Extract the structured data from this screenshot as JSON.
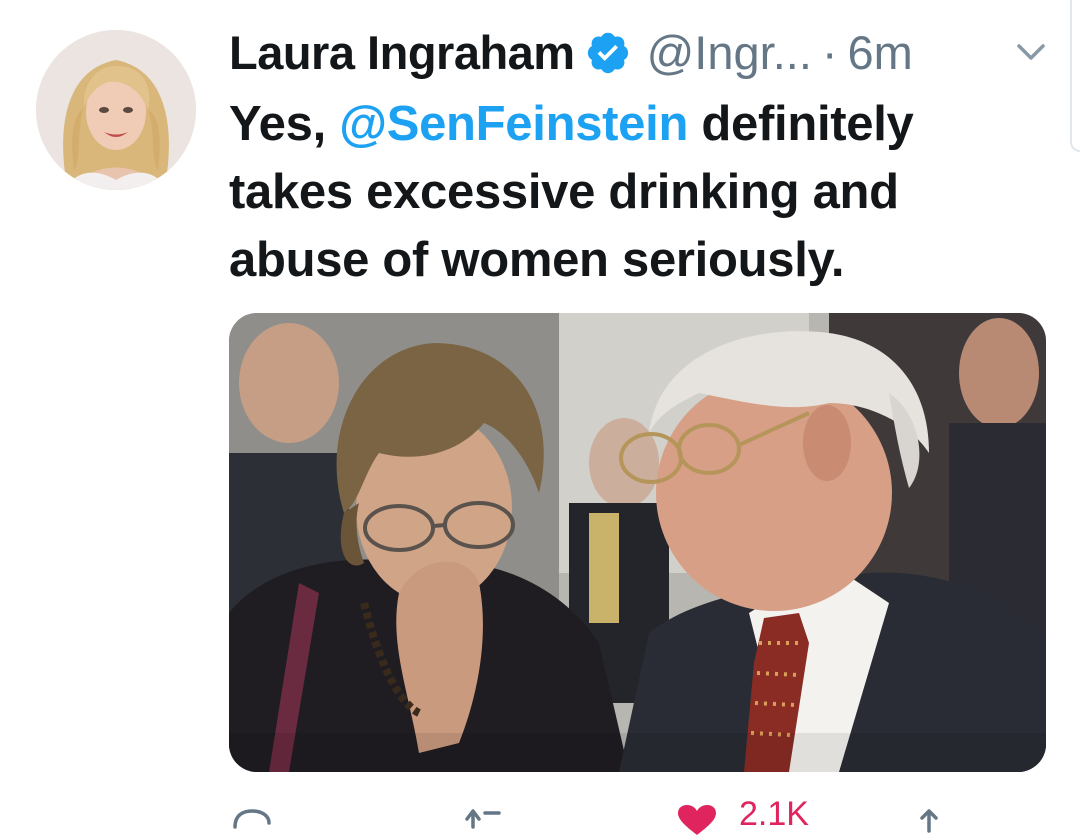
{
  "tweet": {
    "author": {
      "display_name": "Laura Ingraham",
      "handle": "@Ingr...",
      "verified_icon": "verified-badge-icon",
      "avatar_icon": "avatar"
    },
    "separator": "·",
    "time": "6m",
    "text": {
      "line1_prefix": "Yes,",
      "mention": "@SenFeinstein",
      "line1_suffix": "definitely",
      "line2": "takes excessive drinking and",
      "line3": "abuse of women seriously."
    },
    "media": {
      "icon": "photo"
    },
    "actions": {
      "reply_icon": "reply-icon",
      "retweet_icon": "retweet-icon",
      "like_icon": "heart-icon",
      "like_count": "2.1K",
      "share_icon": "share-icon"
    },
    "menu_icon": "chevron-down-icon"
  },
  "colors": {
    "text": "#14171a",
    "secondary": "#657786",
    "link": "#1da1f2",
    "verified": "#1da1f2",
    "like": "#e0245e"
  }
}
